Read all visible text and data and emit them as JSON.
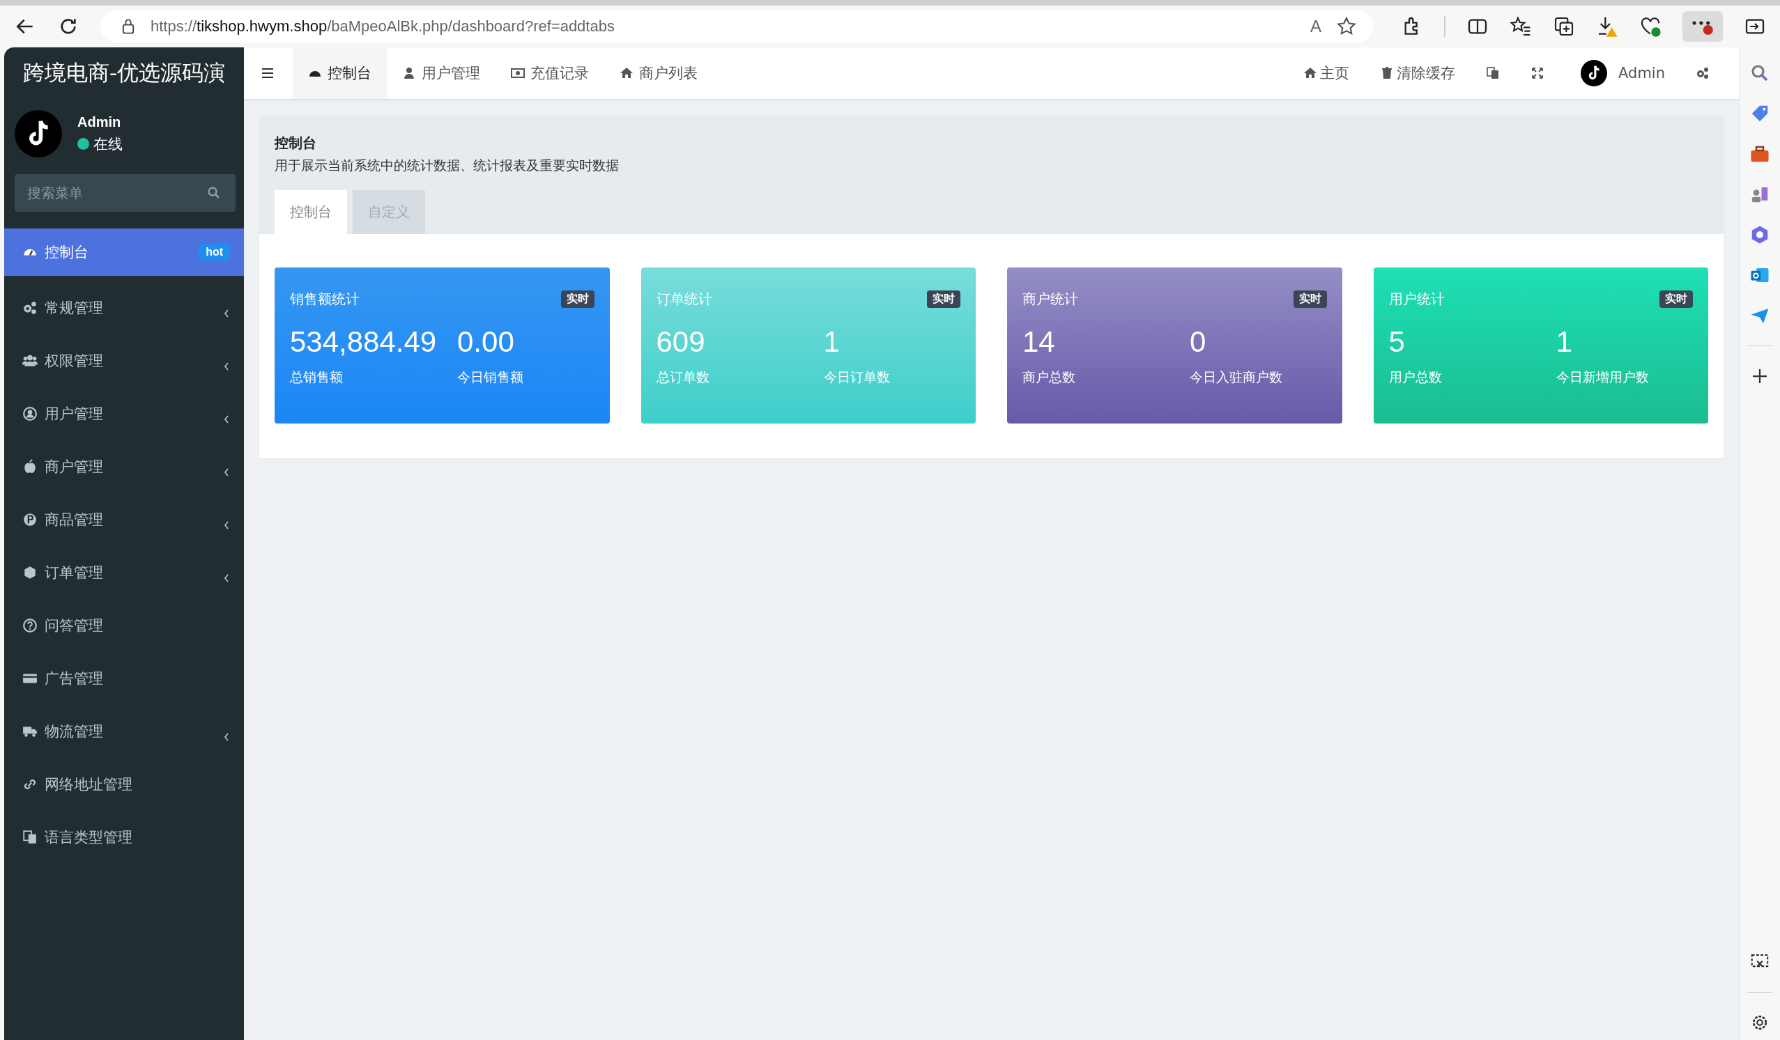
{
  "browser": {
    "url_scheme": "https://",
    "url_host": "tikshop.hwym.shop",
    "url_path": "/baMpeoAlBk.php/dashboard?ref=addtabs",
    "read_aloud_label": "A"
  },
  "sidebar": {
    "logo_title": "跨境电商-优选源码演",
    "user": {
      "name": "Admin",
      "status": "在线"
    },
    "search": {
      "placeholder": "搜索菜单"
    },
    "menu": [
      {
        "label": "控制台",
        "selected": true,
        "expandable": false,
        "badge": "hot"
      },
      {
        "label": "常规管理",
        "selected": false,
        "expandable": true
      },
      {
        "label": "权限管理",
        "selected": false,
        "expandable": true
      },
      {
        "label": "用户管理",
        "selected": false,
        "expandable": true
      },
      {
        "label": "商户管理",
        "selected": false,
        "expandable": true
      },
      {
        "label": "商品管理",
        "selected": false,
        "expandable": true
      },
      {
        "label": "订单管理",
        "selected": false,
        "expandable": true
      },
      {
        "label": "问答管理",
        "selected": false,
        "expandable": false
      },
      {
        "label": "广告管理",
        "selected": false,
        "expandable": false
      },
      {
        "label": "物流管理",
        "selected": false,
        "expandable": true
      },
      {
        "label": "网络地址管理",
        "selected": false,
        "expandable": false
      },
      {
        "label": "语言类型管理",
        "selected": false,
        "expandable": false
      }
    ]
  },
  "topbar": {
    "tabs": [
      {
        "label": "控制台",
        "selected": true
      },
      {
        "label": "用户管理",
        "selected": false
      },
      {
        "label": "充值记录",
        "selected": false
      },
      {
        "label": "商户列表",
        "selected": false
      }
    ],
    "links": [
      {
        "label": "主页"
      },
      {
        "label": "清除缓存"
      }
    ],
    "admin_name": "Admin"
  },
  "panel": {
    "title": "控制台",
    "description": "用于展示当前系统中的统计数据、统计报表及重要实时数据",
    "tabs": [
      {
        "label": "控制台",
        "selected": true
      },
      {
        "label": "自定义",
        "selected": false
      }
    ]
  },
  "cards": [
    {
      "title": "销售额统计",
      "badge": "实时",
      "stats": [
        {
          "value": "534,884.49",
          "label": "总销售额"
        },
        {
          "value": "0.00",
          "label": "今日销售额"
        }
      ]
    },
    {
      "title": "订单统计",
      "badge": "实时",
      "stats": [
        {
          "value": "609",
          "label": "总订单数"
        },
        {
          "value": "1",
          "label": "今日订单数"
        }
      ]
    },
    {
      "title": "商户统计",
      "badge": "实时",
      "stats": [
        {
          "value": "14",
          "label": "商户总数"
        },
        {
          "value": "0",
          "label": "今日入驻商户数"
        }
      ]
    },
    {
      "title": "用户统计",
      "badge": "实时",
      "stats": [
        {
          "value": "5",
          "label": "用户总数"
        },
        {
          "value": "1",
          "label": "今日新增用户数"
        }
      ]
    }
  ]
}
